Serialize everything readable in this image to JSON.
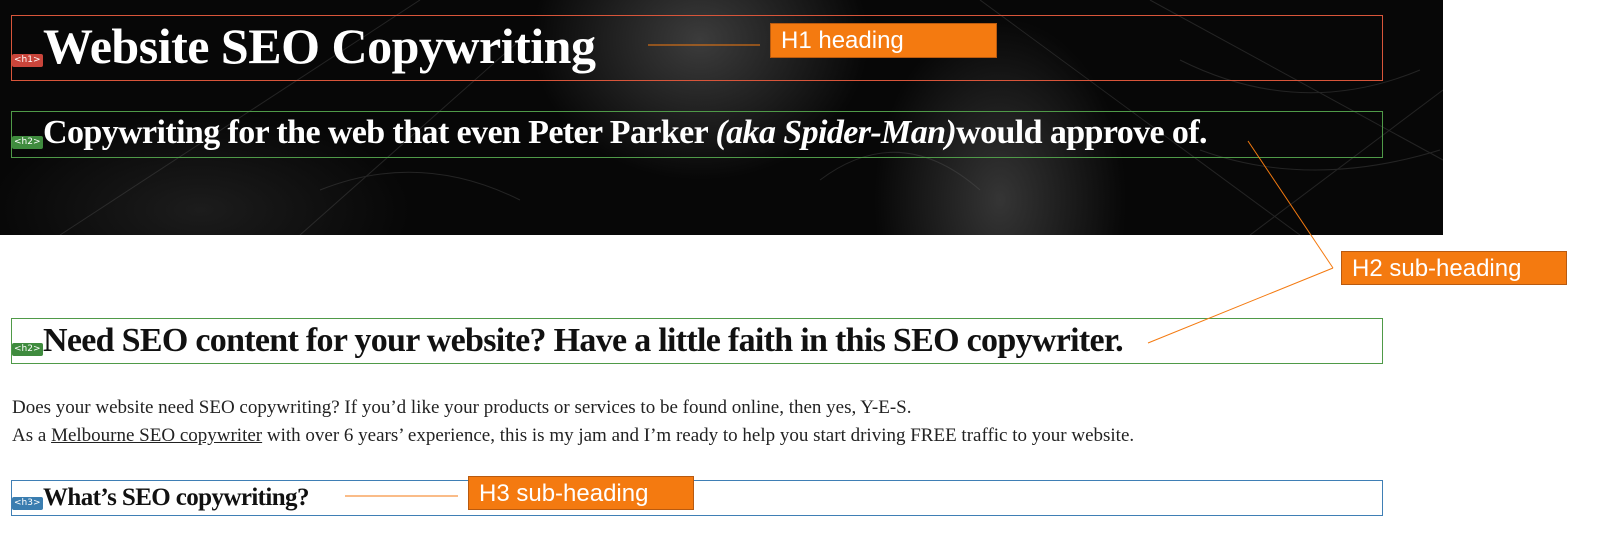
{
  "hero": {
    "h1_tag": "<h1>",
    "h1_text": "Website  SEO Copywriting",
    "h2_tag": "<h2>",
    "h2_text_before": "Copywriting for the web that even Peter Parker ",
    "h2_text_italic": "(aka Spider-Man)",
    "h2_text_after": "would approve of."
  },
  "main": {
    "h2_tag": "<h2>",
    "h2_text": "Need SEO content for your website? Have a little faith in this SEO copywriter.",
    "paragraph1": "Does your website need SEO copywriting? If you’d like your products or services to be found online, then yes, Y-E-S.",
    "paragraph2_before": "As a ",
    "paragraph2_link": "Melbourne SEO copywriter",
    "paragraph2_after": " with over 6 years’ experience, this is my jam and I’m ready to help you start driving FREE traffic to your website.",
    "h3_tag": "<h3>",
    "h3_text": "What’s SEO copywriting?"
  },
  "callouts": {
    "h1": "H1 heading",
    "h2": "H2 sub-heading",
    "h3": "H3 sub-heading"
  },
  "colors": {
    "h1_outline": "#d8553a",
    "h2_outline": "#4f9a48",
    "h3_outline": "#3f7fb5",
    "callout_bg": "#f47a10"
  }
}
